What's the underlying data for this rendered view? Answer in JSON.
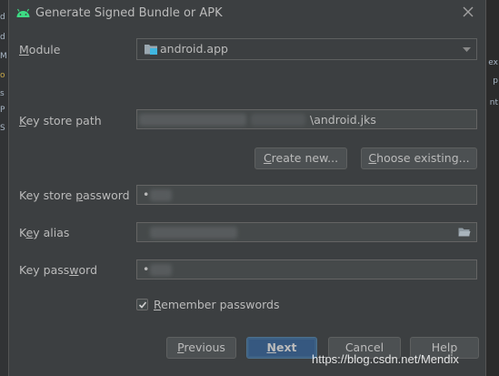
{
  "dialog": {
    "title": "Generate Signed Bundle or APK"
  },
  "module": {
    "label_pre": "",
    "label_key": "M",
    "label_post": "odule",
    "value": "android.app"
  },
  "key_store_path": {
    "label_pre": "",
    "label_key": "K",
    "label_post": "ey store path",
    "value": "\\android.jks"
  },
  "buttons": {
    "create_new_key": "C",
    "create_new_rest": "reate new...",
    "choose_existing_pre": "",
    "choose_existing_key": "C",
    "choose_existing_rest": "hoose existing...",
    "previous_key": "P",
    "previous_rest": "revious",
    "next_key": "N",
    "next_rest": "ext",
    "cancel": "Cancel",
    "help": "Help"
  },
  "key_store_password": {
    "label_pre": "Key store ",
    "label_key": "p",
    "label_post": "assword",
    "value": "•"
  },
  "key_alias": {
    "label_pre": "K",
    "label_key": "e",
    "label_post": "y alias",
    "value": ""
  },
  "key_password": {
    "label_pre": "Key pass",
    "label_key": "w",
    "label_post": "ord",
    "value": "•"
  },
  "remember": {
    "label_key": "R",
    "label_rest": "emember passwords",
    "checked": true
  },
  "watermark": "https://blog.csdn.net/Mendix",
  "background": {
    "left_chars": [
      "d",
      "d",
      "M",
      "o",
      "s",
      "P",
      "S"
    ],
    "right_chars": [
      "ex",
      "p",
      "nt"
    ]
  },
  "colors": {
    "dialog_bg": "#3c3f41",
    "field_bg": "#45494a",
    "primary_button": "#365880",
    "android_green": "#3ddc84"
  }
}
